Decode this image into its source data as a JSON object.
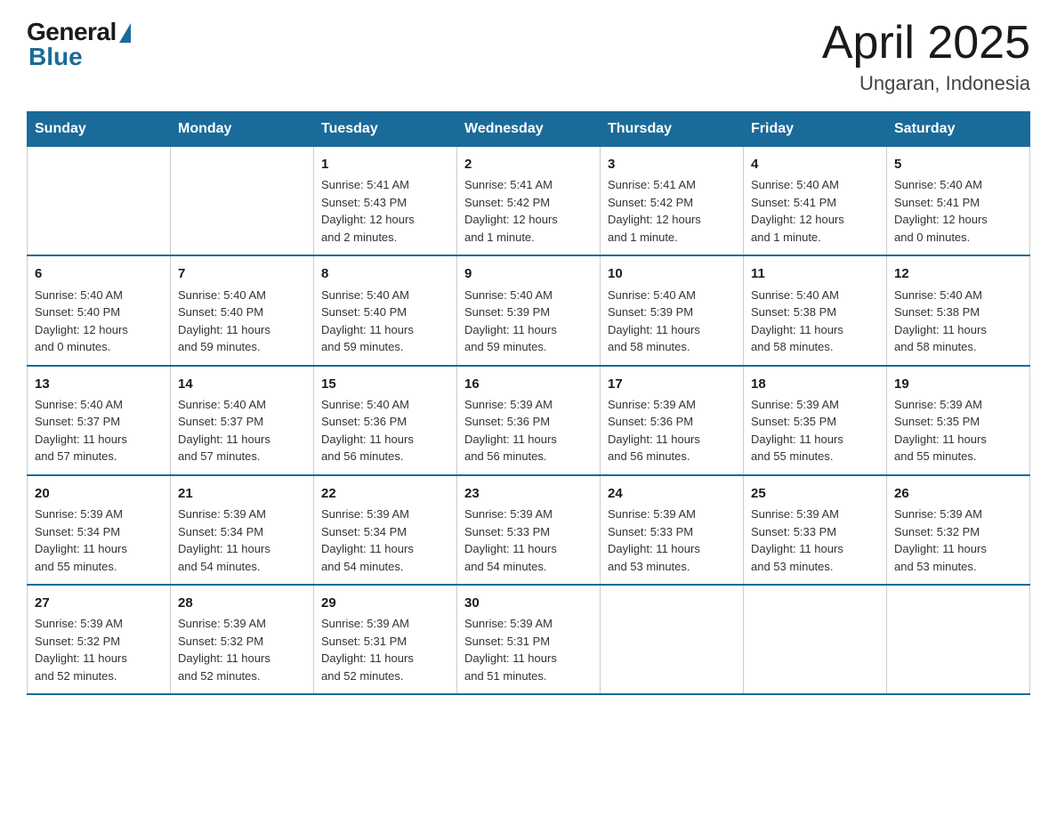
{
  "header": {
    "logo_general": "General",
    "logo_blue": "Blue",
    "title": "April 2025",
    "subtitle": "Ungaran, Indonesia"
  },
  "days_of_week": [
    "Sunday",
    "Monday",
    "Tuesday",
    "Wednesday",
    "Thursday",
    "Friday",
    "Saturday"
  ],
  "weeks": [
    [
      {
        "day": "",
        "info": ""
      },
      {
        "day": "",
        "info": ""
      },
      {
        "day": "1",
        "info": "Sunrise: 5:41 AM\nSunset: 5:43 PM\nDaylight: 12 hours\nand 2 minutes."
      },
      {
        "day": "2",
        "info": "Sunrise: 5:41 AM\nSunset: 5:42 PM\nDaylight: 12 hours\nand 1 minute."
      },
      {
        "day": "3",
        "info": "Sunrise: 5:41 AM\nSunset: 5:42 PM\nDaylight: 12 hours\nand 1 minute."
      },
      {
        "day": "4",
        "info": "Sunrise: 5:40 AM\nSunset: 5:41 PM\nDaylight: 12 hours\nand 1 minute."
      },
      {
        "day": "5",
        "info": "Sunrise: 5:40 AM\nSunset: 5:41 PM\nDaylight: 12 hours\nand 0 minutes."
      }
    ],
    [
      {
        "day": "6",
        "info": "Sunrise: 5:40 AM\nSunset: 5:40 PM\nDaylight: 12 hours\nand 0 minutes."
      },
      {
        "day": "7",
        "info": "Sunrise: 5:40 AM\nSunset: 5:40 PM\nDaylight: 11 hours\nand 59 minutes."
      },
      {
        "day": "8",
        "info": "Sunrise: 5:40 AM\nSunset: 5:40 PM\nDaylight: 11 hours\nand 59 minutes."
      },
      {
        "day": "9",
        "info": "Sunrise: 5:40 AM\nSunset: 5:39 PM\nDaylight: 11 hours\nand 59 minutes."
      },
      {
        "day": "10",
        "info": "Sunrise: 5:40 AM\nSunset: 5:39 PM\nDaylight: 11 hours\nand 58 minutes."
      },
      {
        "day": "11",
        "info": "Sunrise: 5:40 AM\nSunset: 5:38 PM\nDaylight: 11 hours\nand 58 minutes."
      },
      {
        "day": "12",
        "info": "Sunrise: 5:40 AM\nSunset: 5:38 PM\nDaylight: 11 hours\nand 58 minutes."
      }
    ],
    [
      {
        "day": "13",
        "info": "Sunrise: 5:40 AM\nSunset: 5:37 PM\nDaylight: 11 hours\nand 57 minutes."
      },
      {
        "day": "14",
        "info": "Sunrise: 5:40 AM\nSunset: 5:37 PM\nDaylight: 11 hours\nand 57 minutes."
      },
      {
        "day": "15",
        "info": "Sunrise: 5:40 AM\nSunset: 5:36 PM\nDaylight: 11 hours\nand 56 minutes."
      },
      {
        "day": "16",
        "info": "Sunrise: 5:39 AM\nSunset: 5:36 PM\nDaylight: 11 hours\nand 56 minutes."
      },
      {
        "day": "17",
        "info": "Sunrise: 5:39 AM\nSunset: 5:36 PM\nDaylight: 11 hours\nand 56 minutes."
      },
      {
        "day": "18",
        "info": "Sunrise: 5:39 AM\nSunset: 5:35 PM\nDaylight: 11 hours\nand 55 minutes."
      },
      {
        "day": "19",
        "info": "Sunrise: 5:39 AM\nSunset: 5:35 PM\nDaylight: 11 hours\nand 55 minutes."
      }
    ],
    [
      {
        "day": "20",
        "info": "Sunrise: 5:39 AM\nSunset: 5:34 PM\nDaylight: 11 hours\nand 55 minutes."
      },
      {
        "day": "21",
        "info": "Sunrise: 5:39 AM\nSunset: 5:34 PM\nDaylight: 11 hours\nand 54 minutes."
      },
      {
        "day": "22",
        "info": "Sunrise: 5:39 AM\nSunset: 5:34 PM\nDaylight: 11 hours\nand 54 minutes."
      },
      {
        "day": "23",
        "info": "Sunrise: 5:39 AM\nSunset: 5:33 PM\nDaylight: 11 hours\nand 54 minutes."
      },
      {
        "day": "24",
        "info": "Sunrise: 5:39 AM\nSunset: 5:33 PM\nDaylight: 11 hours\nand 53 minutes."
      },
      {
        "day": "25",
        "info": "Sunrise: 5:39 AM\nSunset: 5:33 PM\nDaylight: 11 hours\nand 53 minutes."
      },
      {
        "day": "26",
        "info": "Sunrise: 5:39 AM\nSunset: 5:32 PM\nDaylight: 11 hours\nand 53 minutes."
      }
    ],
    [
      {
        "day": "27",
        "info": "Sunrise: 5:39 AM\nSunset: 5:32 PM\nDaylight: 11 hours\nand 52 minutes."
      },
      {
        "day": "28",
        "info": "Sunrise: 5:39 AM\nSunset: 5:32 PM\nDaylight: 11 hours\nand 52 minutes."
      },
      {
        "day": "29",
        "info": "Sunrise: 5:39 AM\nSunset: 5:31 PM\nDaylight: 11 hours\nand 52 minutes."
      },
      {
        "day": "30",
        "info": "Sunrise: 5:39 AM\nSunset: 5:31 PM\nDaylight: 11 hours\nand 51 minutes."
      },
      {
        "day": "",
        "info": ""
      },
      {
        "day": "",
        "info": ""
      },
      {
        "day": "",
        "info": ""
      }
    ]
  ]
}
